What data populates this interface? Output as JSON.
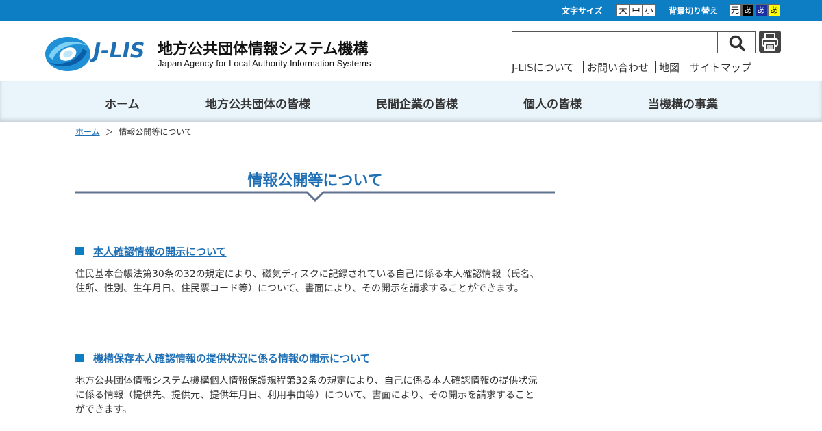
{
  "topbar": {
    "font_size_label": "文字サイズ",
    "font_sizes": [
      "大",
      "中",
      "小"
    ],
    "bg_label": "背景切り替え",
    "bg_options": [
      "元",
      "あ",
      "あ",
      "あ"
    ],
    "colors": {
      "bar": "#0d7dc4"
    }
  },
  "header": {
    "logo_text": "J-LIS",
    "org_name_ja": "地方公共団体情報システム機構",
    "org_name_en": "Japan Agency for Local Authority Information Systems",
    "search": {
      "value": "",
      "icon": "search-icon"
    },
    "print_icon": "printer-icon",
    "links": [
      "J-LISについて",
      "お問い合わせ",
      "地図",
      "サイトマップ"
    ]
  },
  "nav": {
    "items": [
      "ホーム",
      "地方公共団体の皆様",
      "民間企業の皆様",
      "個人の皆様",
      "当機構の事業"
    ]
  },
  "breadcrumb": {
    "home": "ホーム",
    "separator": "＞",
    "current": "情報公開等について"
  },
  "page": {
    "title": "情報公開等について",
    "sections": [
      {
        "link": "本人確認情報の開示について",
        "body": "住民基本台帳法第30条の32の規定により、磁気ディスクに記録されている自己に係る本人確認情報（氏名、住所、性別、生年月日、住民票コード等）について、書面により、その開示を請求することができます。"
      },
      {
        "link": "機構保存本人確認情報の提供状況に係る情報の開示について",
        "body": "地方公共団体情報システム機構個人情報保護規程第32条の規定により、自己に係る本人確認情報の提供状況に係る情報（提供先、提供元、提供年月日、利用事由等）について、書面により、その開示を請求することができます。"
      }
    ]
  },
  "accent": "#1f6fb5"
}
